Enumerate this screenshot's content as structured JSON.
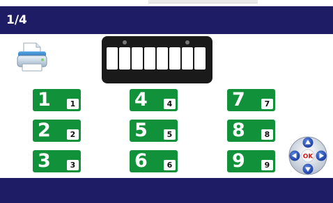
{
  "header": {
    "page_indicator": "1/4"
  },
  "keypad": {
    "keys": [
      {
        "big": "1",
        "small": "1"
      },
      {
        "big": "2",
        "small": "2"
      },
      {
        "big": "3",
        "small": "3"
      },
      {
        "big": "4",
        "small": "4"
      },
      {
        "big": "5",
        "small": "5"
      },
      {
        "big": "6",
        "small": "6"
      },
      {
        "big": "7",
        "small": "7"
      },
      {
        "big": "8",
        "small": "8"
      },
      {
        "big": "9",
        "small": "9"
      }
    ]
  },
  "dpad": {
    "ok_label": "OK"
  },
  "icons": {
    "printer": "printer-icon",
    "dpad": "dpad-icon",
    "plate": "license-plate-icon"
  },
  "colors": {
    "header_bg": "#1e1c64",
    "key_green": "#11923a",
    "dpad_blue": "#1d3fa3"
  }
}
